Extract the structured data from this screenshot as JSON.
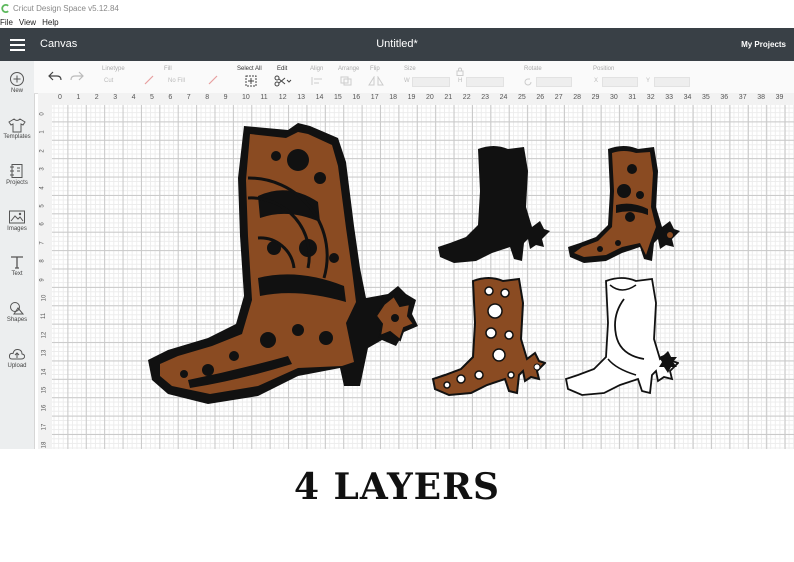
{
  "window": {
    "title": "Cricut Design Space  v5.12.84"
  },
  "menu": [
    "File",
    "View",
    "Help"
  ],
  "header": {
    "section": "Canvas",
    "document_title": "Untitled*",
    "my_projects": "My Projects"
  },
  "sidebar": [
    {
      "label": "New",
      "icon": "plus-circle-icon"
    },
    {
      "label": "Templates",
      "icon": "tshirt-icon"
    },
    {
      "label": "Projects",
      "icon": "projects-icon"
    },
    {
      "label": "Images",
      "icon": "image-icon"
    },
    {
      "label": "Text",
      "icon": "text-icon"
    },
    {
      "label": "Shapes",
      "icon": "shapes-icon"
    },
    {
      "label": "Upload",
      "icon": "cloud-upload-icon"
    }
  ],
  "toolbar": {
    "linetype_label": "Linetype",
    "linetype_value": "Cut",
    "fill_label": "Fill",
    "fill_value": "No Fill",
    "select_all": "Select All",
    "edit": "Edit",
    "align": "Align",
    "arrange": "Arrange",
    "flip": "Flip",
    "size": "Size",
    "size_w": "W",
    "size_h": "H",
    "rotate": "Rotate",
    "position": "Position",
    "pos_x": "X",
    "pos_y": "Y"
  },
  "ruler": {
    "top": [
      "0",
      "1",
      "2",
      "3",
      "4",
      "5",
      "6",
      "7",
      "8",
      "9",
      "10",
      "11",
      "12",
      "13",
      "14",
      "15",
      "16",
      "17",
      "18",
      "19",
      "20",
      "21",
      "22",
      "23",
      "24",
      "25",
      "26",
      "27",
      "28",
      "29",
      "30",
      "31",
      "32",
      "33",
      "34",
      "35",
      "36",
      "37",
      "38",
      "39"
    ],
    "left": [
      "0",
      "1",
      "2",
      "3",
      "4",
      "5",
      "6",
      "7",
      "8",
      "9",
      "10",
      "11",
      "12",
      "13",
      "14",
      "15",
      "16",
      "17",
      "18"
    ]
  },
  "caption": "4 LAYERS",
  "colors": {
    "topbar": "#394046",
    "leather": "#8a4b22",
    "dark": "#111111"
  }
}
